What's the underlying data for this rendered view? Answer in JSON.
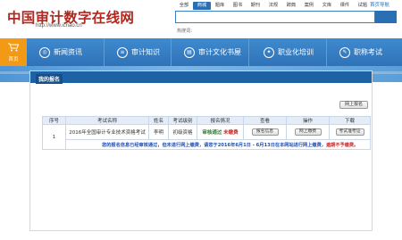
{
  "site": {
    "logo_text": "中国审计数字在线网",
    "url_text": "http://www.icnao.cn"
  },
  "top_tabs": [
    "全部",
    "商城",
    "题库",
    "图书",
    "期刊",
    "法规",
    "辞典",
    "案例",
    "文库",
    "课件",
    "试题"
  ],
  "top_link": "首页导航",
  "hot_search": "热搜词：",
  "nav": {
    "home_label": "首页",
    "items": [
      "新闻资讯",
      "审计知识",
      "审计文化书屋",
      "职业化培训",
      "职称考试"
    ]
  },
  "panel": {
    "title": "我的报名",
    "online_button": "网上报名"
  },
  "table": {
    "headers": [
      "序号",
      "考试名称",
      "姓名",
      "考试级别",
      "报名情况",
      "查看",
      "操作",
      "下载"
    ],
    "row": {
      "index": "1",
      "exam_name": "2016年全国审计专业技术资格考试",
      "name": "李明",
      "level": "初级资格",
      "status_pass": "审核通过",
      "status_unpaid": "未缴费",
      "view_button": "报名信息",
      "action_button": "网上缴费",
      "download_button": "考试准考证"
    },
    "notice_blue": "您的报名信息已经审核通过，但未进行网上缴费，请您于2016年6月1日 - 6月13日在本网站进行网上缴费，",
    "notice_red": "逾期不予缴费。"
  },
  "colors": {
    "nav_bg": "#3a84c9",
    "home_bg": "#f29a15",
    "panel_header": "#1e62a5",
    "logo": "#b3261e"
  }
}
